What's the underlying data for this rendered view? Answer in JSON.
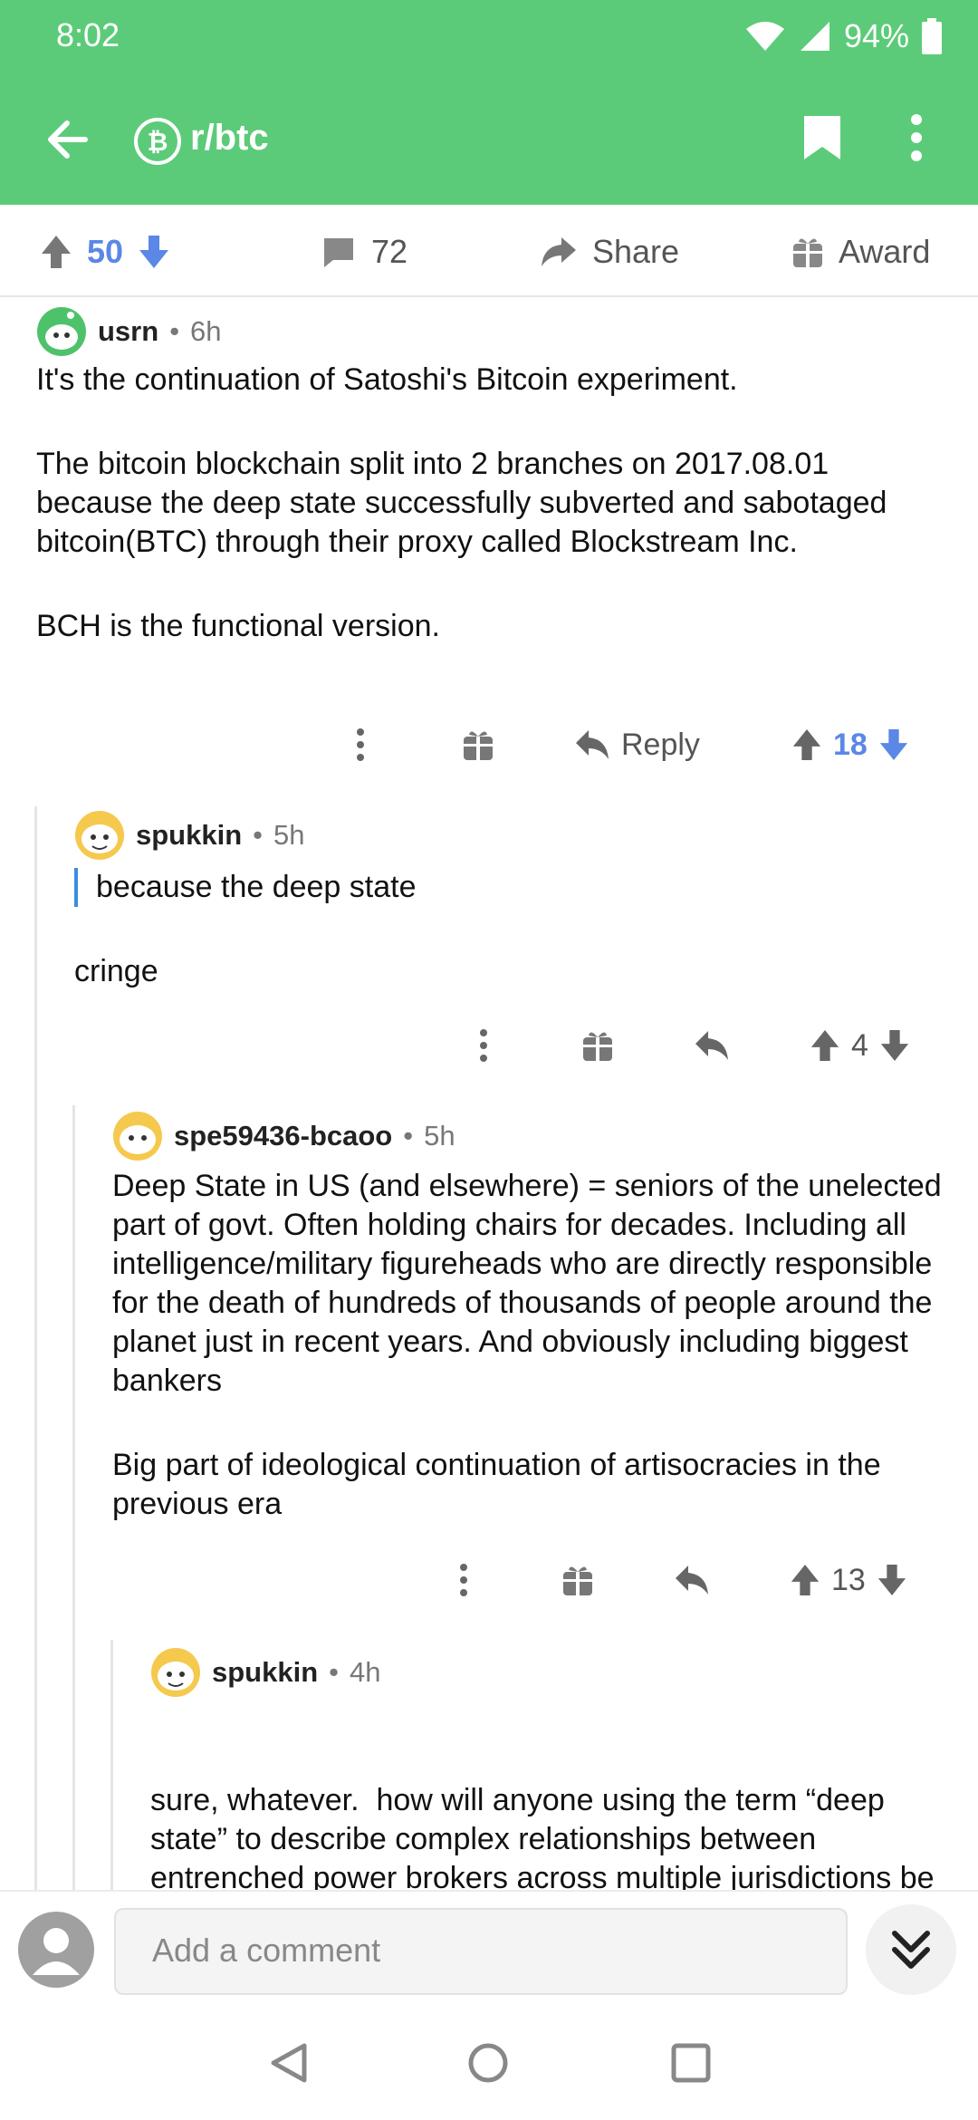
{
  "status_bar": {
    "time": "8:02",
    "battery": "94%"
  },
  "toolbar": {
    "subreddit": "r/btc",
    "icons": [
      "back-icon",
      "subreddit-icon",
      "bookmark-icon",
      "more-icon"
    ]
  },
  "post_actions": {
    "votes": "50",
    "comments": "72",
    "share": "Share",
    "award": "Award"
  },
  "comments": [
    {
      "user": "usrn",
      "age": "6h",
      "paragraphs": [
        "It's the continuation of Satoshi's Bitcoin experiment.",
        "The bitcoin blockchain split into 2 branches on 2017.08.01 because the deep state successfully subverted and sabotaged bitcoin(BTC) through their proxy called Blockstream Inc.",
        "BCH is the functional version."
      ],
      "reply_label": "Reply",
      "score": "18"
    },
    {
      "user": "spukkin",
      "age": "5h",
      "quote": "because the deep state",
      "paragraphs": [
        "cringe"
      ],
      "score": "4"
    },
    {
      "user": "spe59436-bcaoo",
      "age": "5h",
      "paragraphs": [
        "Deep State in US (and elsewhere) = seniors of the unelected part of govt. Often holding chairs for decades. Including all intelligence/military figureheads who are directly responsible for the death of hundreds of thousands of people around the planet just in recent years. And obviously including biggest bankers",
        "Big part of ideological continuation of artisocracies in the previous era"
      ],
      "score": "13"
    },
    {
      "user": "spukkin",
      "age": "4h",
      "paragraphs": [
        "sure, whatever.  how will anyone using the term “deep state” to describe complex relationships between entrenched power brokers across multiple jurisdictions be able to differentiate themselves from Q anon mental patients going forward?"
      ]
    }
  ],
  "composer": {
    "placeholder": "Add a comment"
  }
}
